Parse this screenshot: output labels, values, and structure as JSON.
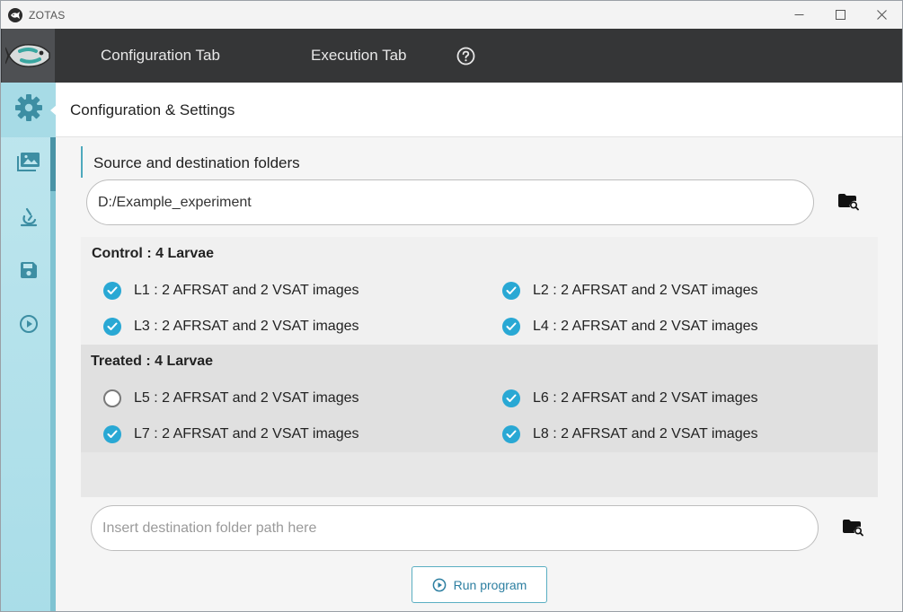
{
  "window": {
    "title": "ZOTAS",
    "controls": {
      "minimize": "—",
      "maximize": "☐",
      "close": "✕"
    }
  },
  "topnav": {
    "tabs": [
      {
        "label": "Configuration Tab"
      },
      {
        "label": "Execution Tab"
      }
    ],
    "help_icon": "help-circle-icon"
  },
  "sidebar": {
    "items": [
      {
        "name": "settings",
        "icon": "gear-icon"
      },
      {
        "name": "images",
        "icon": "gallery-icon"
      },
      {
        "name": "microscope",
        "icon": "microscope-icon"
      },
      {
        "name": "save",
        "icon": "save-icon"
      },
      {
        "name": "run",
        "icon": "play-icon"
      }
    ]
  },
  "header": {
    "title": "Configuration & Settings"
  },
  "folders": {
    "section_label": "Source and destination folders",
    "source_value": "D:/Example_experiment",
    "destination_placeholder": "Insert destination folder path here"
  },
  "groups": [
    {
      "title": "Control  :  4 Larvae",
      "larvae": [
        {
          "label": "L1 : 2 AFRSAT and 2 VSAT images",
          "checked": true
        },
        {
          "label": "L2 : 2 AFRSAT and 2 VSAT images",
          "checked": true
        },
        {
          "label": "L3 : 2 AFRSAT and 2 VSAT images",
          "checked": true
        },
        {
          "label": "L4 : 2 AFRSAT and 2 VSAT images",
          "checked": true
        }
      ]
    },
    {
      "title": "Treated  :  4 Larvae",
      "larvae": [
        {
          "label": "L5 : 2 AFRSAT and 2 VSAT images",
          "checked": false
        },
        {
          "label": "L6 : 2 AFRSAT and 2 VSAT images",
          "checked": true
        },
        {
          "label": "L7 : 2 AFRSAT and 2 VSAT images",
          "checked": true
        },
        {
          "label": "L8 : 2 AFRSAT and 2 VSAT images",
          "checked": true
        }
      ]
    }
  ],
  "run_button": {
    "label": "Run program"
  },
  "colors": {
    "accent": "#29a8d4",
    "nav_bg": "#353637",
    "sidebar_bg": "#a9dde8"
  }
}
